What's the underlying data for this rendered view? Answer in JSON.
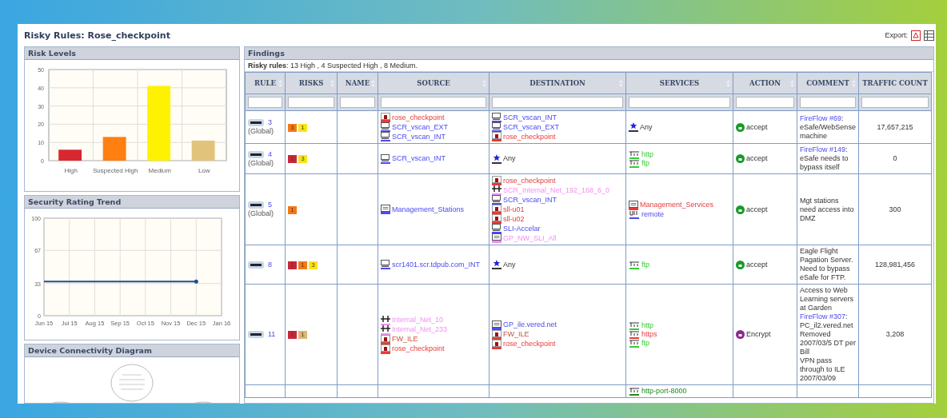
{
  "title": "Risky Rules: Rose_checkpoint",
  "export": {
    "label": "Export:"
  },
  "risk_levels": {
    "title": "Risk Levels",
    "chart_data": {
      "type": "bar",
      "categories": [
        "High",
        "Suspected High",
        "Medium",
        "Low"
      ],
      "values": [
        6,
        13,
        41,
        11
      ],
      "colors": [
        "#d8282f",
        "#ff7f10",
        "#fff200",
        "#e2c37c"
      ],
      "ylim": [
        0,
        50
      ],
      "yticks": [
        0,
        10,
        20,
        30,
        40,
        50
      ],
      "grid": true
    }
  },
  "trend": {
    "title": "Security Rating Trend",
    "chart_data": {
      "type": "line",
      "x": [
        "Jun 15",
        "Jul 15",
        "Aug 15",
        "Sep 15",
        "Oct 15",
        "Nov 15",
        "Dec 15",
        "Jan 16"
      ],
      "series": [
        {
          "color": "#1f4f8f",
          "values": [
            35,
            35,
            35,
            35,
            35,
            35,
            35,
            null
          ]
        }
      ],
      "ylim": [
        0,
        100
      ],
      "yticks": [
        0,
        33,
        67,
        100
      ],
      "grid": true
    }
  },
  "connectivity": {
    "title": "Device Connectivity Diagram"
  },
  "findings": {
    "title": "Findings",
    "summary": "**Risky rules**: 13 High , 4 Suspected High , 8 Medium.",
    "columns": [
      {
        "label": "RULE",
        "sortable": true
      },
      {
        "label": "RISKS",
        "sortable": true
      },
      {
        "label": "NAME",
        "sortable": true
      },
      {
        "label": "SOURCE",
        "sortable": true
      },
      {
        "label": "DESTINATION",
        "sortable": true
      },
      {
        "label": "SERVICES",
        "sortable": true
      },
      {
        "label": "ACTION",
        "sortable": true
      },
      {
        "label": "COMMENT",
        "sortable": true
      },
      {
        "label": "TRAFFIC COUNT",
        "sortable": false
      }
    ],
    "rows": [
      {
        "rule": "3",
        "scope": "(Global)",
        "risks": [
          {
            "text": "3",
            "color": "#f07a1a"
          },
          {
            "text": "1",
            "color": "#f5e61a"
          }
        ],
        "source": [
          {
            "kind": "gateway",
            "text": "rose_checkpoint",
            "color": "#e83a3a"
          },
          {
            "kind": "host",
            "text": "SCR_vscan_EXT",
            "color": "#4a4af0"
          },
          {
            "kind": "host",
            "text": "SCR_vscan_INT",
            "color": "#4a4af0"
          }
        ],
        "destination": [
          {
            "kind": "host",
            "text": "SCR_vscan_INT",
            "color": "#4a4af0"
          },
          {
            "kind": "host",
            "text": "SCR_vscan_EXT",
            "color": "#4a4af0"
          },
          {
            "kind": "gateway",
            "text": "rose_checkpoint",
            "color": "#e83a3a"
          }
        ],
        "services": [
          {
            "kind": "any",
            "text": "Any",
            "color": "#333333"
          }
        ],
        "action": {
          "kind": "accept",
          "text": "accept"
        },
        "comment": [
          {
            "kind": "link",
            "text": "FireFlow #69",
            "suffix": ":"
          },
          {
            "kind": "text",
            "text": "eSafe/WebSense machine"
          }
        ],
        "traffic": "17,657,215"
      },
      {
        "rule": "4",
        "scope": "(Global)",
        "risks": [
          {
            "text": "1",
            "color": "#c8283a"
          },
          {
            "text": "3",
            "color": "#f5e61a"
          }
        ],
        "source": [
          {
            "kind": "host",
            "text": "SCR_vscan_INT",
            "color": "#4a4af0"
          }
        ],
        "destination": [
          {
            "kind": "any",
            "text": "Any",
            "color": "#333333"
          }
        ],
        "services": [
          {
            "kind": "tcp",
            "text": "http",
            "color": "#33cc33"
          },
          {
            "kind": "tcp",
            "text": "ftp",
            "color": "#33cc33"
          }
        ],
        "action": {
          "kind": "accept",
          "text": "accept"
        },
        "comment": [
          {
            "kind": "link",
            "text": "FireFlow #149",
            "suffix": ":"
          },
          {
            "kind": "text",
            "text": "eSafe needs to bypass itself"
          }
        ],
        "traffic": "0"
      },
      {
        "rule": "5",
        "scope": "(Global)",
        "risks": [
          {
            "text": "1",
            "color": "#f07a1a"
          }
        ],
        "source": [
          {
            "kind": "group",
            "text": "Management_Stations",
            "color": "#4a4af0"
          }
        ],
        "destination": [
          {
            "kind": "gateway",
            "text": "rose_checkpoint",
            "color": "#e83a3a"
          },
          {
            "kind": "network",
            "text": "SCR_Internal_Net_192_168_6_0",
            "color": "#f090f0"
          },
          {
            "kind": "host",
            "text": "SCR_vscan_INT",
            "color": "#4a4af0"
          },
          {
            "kind": "gateway",
            "text": "sll-u01",
            "color": "#e83a3a"
          },
          {
            "kind": "gateway",
            "text": "sll-u02",
            "color": "#e83a3a"
          },
          {
            "kind": "host",
            "text": "SLI-Accelar",
            "color": "#4a4af0"
          },
          {
            "kind": "group",
            "text": "GP_NW_SLI_All",
            "color": "#f090f0"
          }
        ],
        "services": [
          {
            "kind": "group",
            "text": "Management_Services",
            "color": "#e83a3a"
          },
          {
            "kind": "udp",
            "text": "remote",
            "color": "#4a4af0"
          }
        ],
        "action": {
          "kind": "accept",
          "text": "accept"
        },
        "comment": [
          {
            "kind": "text",
            "text": "Mgt stations need access into DMZ"
          }
        ],
        "traffic": "300"
      },
      {
        "rule": "8",
        "risks": [
          {
            "text": "1",
            "color": "#c8283a"
          },
          {
            "text": "1",
            "color": "#f07a1a"
          },
          {
            "text": "3",
            "color": "#f5e61a"
          }
        ],
        "source": [
          {
            "kind": "host",
            "text": "scr1401.scr.tdpub.com_INT",
            "color": "#4a4af0"
          }
        ],
        "destination": [
          {
            "kind": "any",
            "text": "Any",
            "color": "#333333"
          }
        ],
        "services": [
          {
            "kind": "tcp",
            "text": "ftp",
            "color": "#33cc33"
          }
        ],
        "action": {
          "kind": "accept",
          "text": "accept"
        },
        "comment": [
          {
            "kind": "text",
            "text": "Eagle Flight Pagation Server. Need to bypass eSafe for FTP."
          }
        ],
        "traffic": "128,981,456"
      },
      {
        "rule": "11",
        "risks": [
          {
            "text": "1",
            "color": "#c8283a"
          },
          {
            "text": "1",
            "color": "#d9b878"
          }
        ],
        "source": [
          {
            "kind": "network",
            "text": "Internal_Net_10",
            "color": "#f090f0"
          },
          {
            "kind": "network",
            "text": "Internal_Net_233",
            "color": "#f090f0"
          },
          {
            "kind": "gateway",
            "text": "FW_ILE",
            "color": "#c85040"
          },
          {
            "kind": "gateway",
            "text": "rose_checkpoint",
            "color": "#e83a3a"
          }
        ],
        "destination": [
          {
            "kind": "group",
            "text": "GP_ile.vered.net",
            "color": "#4a4af0"
          },
          {
            "kind": "gateway",
            "text": "FW_ILE",
            "color": "#c85040"
          },
          {
            "kind": "gateway",
            "text": "rose_checkpoint",
            "color": "#e83a3a"
          }
        ],
        "services": [
          {
            "kind": "tcp",
            "text": "http",
            "color": "#33cc33"
          },
          {
            "kind": "tcp",
            "text": "https",
            "color": "#e83a3a"
          },
          {
            "kind": "tcp",
            "text": "ftp",
            "color": "#33cc33"
          }
        ],
        "action": {
          "kind": "encrypt",
          "text": "Encrypt"
        },
        "comment": [
          {
            "kind": "text",
            "text": "Access to Web Learning servers at Garden"
          },
          {
            "kind": "link",
            "text": "FireFlow #307",
            "suffix": ":"
          },
          {
            "kind": "text",
            "text": "PC_il2.vered.net Removed 2007/03/5 DT per Bill"
          },
          {
            "kind": "text",
            "text": "VPN pass through to ILE 2007/03/09"
          }
        ],
        "traffic": "3,208"
      },
      {
        "services": [
          {
            "kind": "tcp",
            "text": "http-port-8000",
            "color": "#228822"
          }
        ]
      }
    ]
  }
}
